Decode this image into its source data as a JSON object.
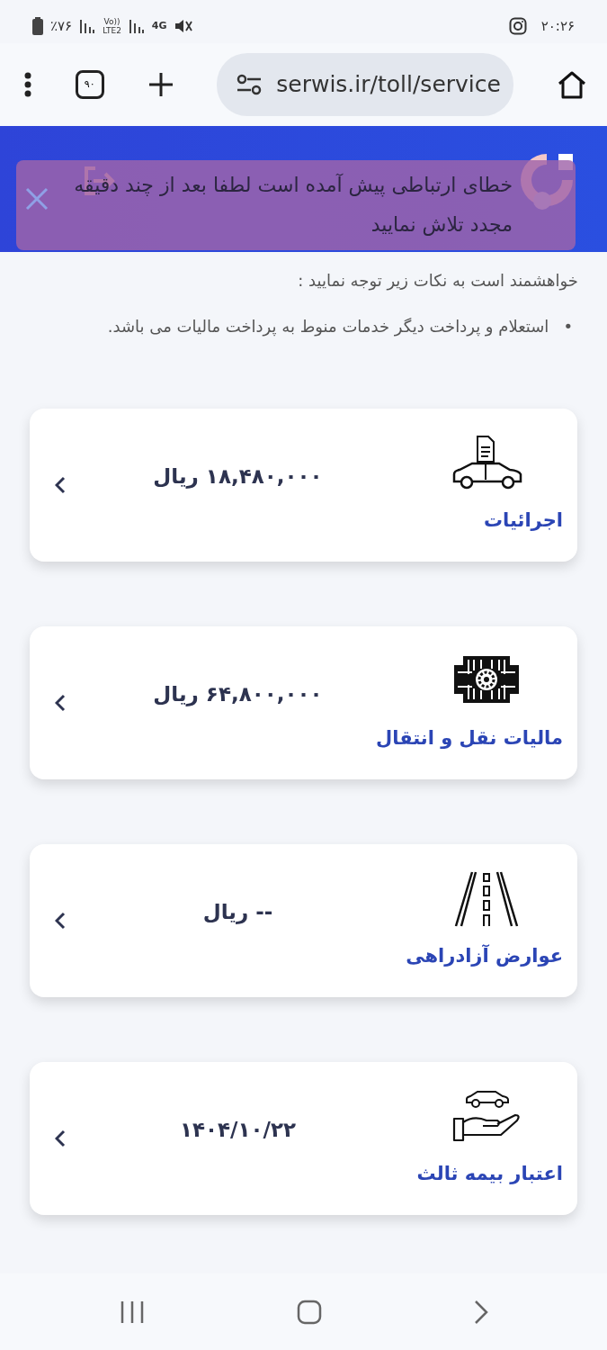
{
  "status_bar": {
    "battery": "٪۷۶",
    "volte": "Vo))",
    "lte": "LTE2",
    "network": "4G",
    "time": "۲۰:۲۶"
  },
  "browser": {
    "tab_count": "۹۰",
    "url": "serwis.ir/toll/service"
  },
  "toast": {
    "message": "خطای ارتباطی پیش آمده است لطفا بعد از چند دقیقه مجدد تلاش نمایید"
  },
  "notice": {
    "intro": "خواهشمند است به نکات زیر توجه نمایید :",
    "bullets": [
      {
        "marker": "•",
        "text": "استعلام و پرداخت دیگر خدمات منوط به پرداخت مالیات می باشد."
      }
    ]
  },
  "services": [
    {
      "kind": "car-document",
      "title": "اجرائیات",
      "value": "۱۸,۴۸۰,۰۰۰ ریال"
    },
    {
      "kind": "emblem",
      "title": "مالیات نقل و انتقال",
      "value": "۶۴,۸۰۰,۰۰۰ ریال"
    },
    {
      "kind": "highway",
      "title": "عوارض آزادراهی",
      "value": "-- ریال"
    },
    {
      "kind": "insurance",
      "title": "اعتبار بیمه ثالث",
      "value": "۱۴۰۴/۱۰/۲۲"
    }
  ]
}
